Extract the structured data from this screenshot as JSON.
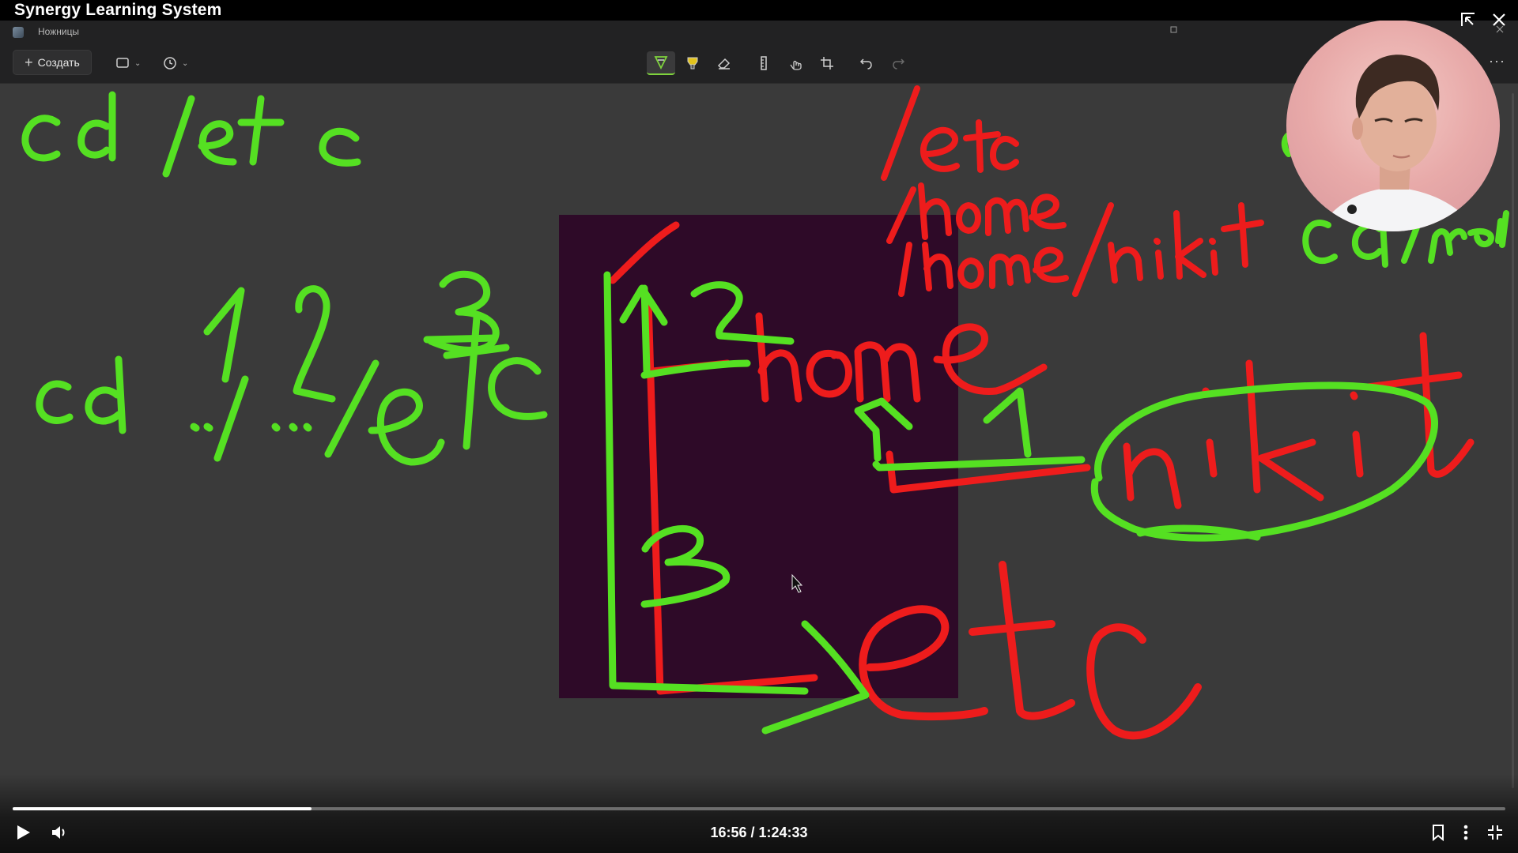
{
  "player": {
    "title": "Synergy Learning System",
    "current_time": "16:56",
    "duration": "1:24:33",
    "time_display": "16:56 / 1:24:33",
    "progress_fraction": 0.2
  },
  "snipping_tool": {
    "app_name": "Ножницы",
    "create_label": "Создать",
    "more_label": "···"
  },
  "whiteboard": {
    "green_text": [
      "cd /etc",
      "cd ../../etc",
      "1",
      "2",
      "3",
      "cd /home"
    ],
    "red_text": [
      "/etc",
      "/home",
      "/home/nikit",
      "home",
      "nikit",
      "etc"
    ]
  },
  "icons": {
    "snip_mode": "rectangle-snip-icon",
    "delay": "clock-icon",
    "pen": "ballpoint-pen-icon",
    "highlighter": "highlighter-icon",
    "eraser": "eraser-icon",
    "ruler": "ruler-icon",
    "touch": "touch-writing-icon",
    "crop": "crop-icon",
    "undo": "undo-icon",
    "redo": "redo-icon",
    "play": "play-icon",
    "volume": "volume-icon",
    "bookmark": "bookmark-icon",
    "menu": "vertical-dots-icon",
    "fullscreen_exit": "exit-fullscreen-icon",
    "close": "close-icon",
    "pip": "picture-in-picture-icon"
  },
  "colors": {
    "ink_green": "#55e022",
    "ink_red": "#ee1c1c",
    "terminal_bg": "#2e0a28",
    "canvas_bg": "#3a3a3a"
  }
}
